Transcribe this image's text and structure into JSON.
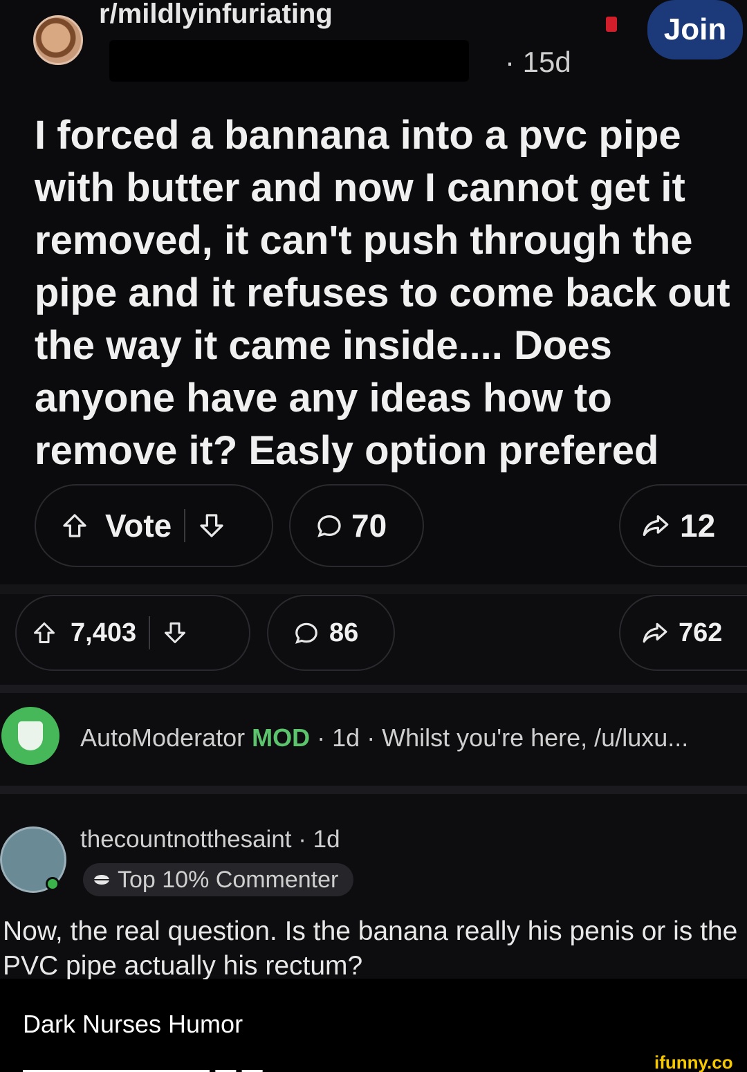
{
  "post": {
    "subreddit": "r/mildlyinfuriating",
    "age": "· 15d",
    "join_label": "Join",
    "title": "I forced a bannana into a pvc pipe with butter and now I cannot get it removed, it can't push through the pipe and it refuses to come back out the way it came inside.... Does anyone have any ideas how to remove it? Easly option prefered",
    "actions": {
      "vote_label": "Vote",
      "comments": "70",
      "shares": "12"
    }
  },
  "outer_actions": {
    "upvotes": "7,403",
    "comments": "86",
    "shares": "762"
  },
  "automod": {
    "username": "AutoModerator",
    "mod_tag": "MOD",
    "meta": " · 1d · Whilst you're here, /u/luxu..."
  },
  "comment": {
    "username": "thecountnotthesaint · 1d",
    "flair": "Top 10% Commenter",
    "text": "Now, the real question. Is the banana really his penis or is the PVC pipe actually his rectum?"
  },
  "footer": {
    "page_name": "Dark Nurses Humor",
    "watermark": "ifunny.co"
  },
  "colors": {
    "join_bg": "#1c3a7a",
    "mod_green": "#5cc46c",
    "watermark": "#f5c800"
  }
}
